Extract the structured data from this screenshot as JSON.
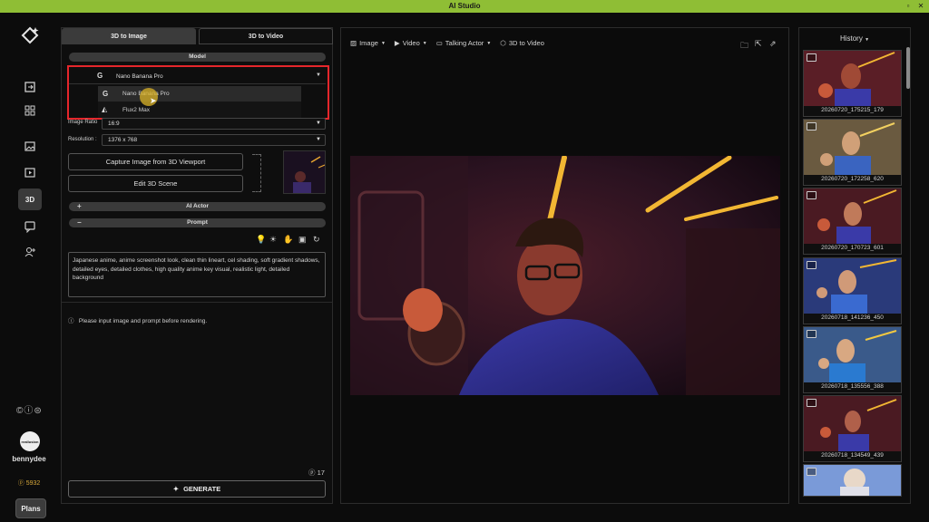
{
  "window": {
    "title": "AI Studio"
  },
  "rail": {
    "license_glyphs": "©ⓘ⊜",
    "avatar_text": "reallusion",
    "username": "bennydee",
    "points": "5932",
    "plans_label": "Plans",
    "icons": [
      "logo-icon",
      "import-icon",
      "grid-icon",
      "image-gen-icon",
      "video-gen-icon",
      "3d-icon",
      "chat-icon",
      "add-user-icon"
    ]
  },
  "left": {
    "tabs": [
      "3D to Image",
      "3D to Video"
    ],
    "model_header": "Model",
    "model_selected": "Nano Banana Pro",
    "model_options": [
      "Nano Banana Pro",
      "Flux2 Max"
    ],
    "image_ratio_label": "Image Ratio",
    "image_ratio_value": "16:9",
    "resolution_label": "Resolution :",
    "resolution_value": "1376 x 768",
    "capture_button": "Capture Image from 3D Viewport",
    "edit_button": "Edit 3D Scene",
    "ai_actor_header": "AI Actor",
    "prompt_header": "Prompt",
    "prompt_text": "Japanese anime, anime screenshot look, clean thin lineart, cel shading, soft gradient shadows, detailed eyes, detailed clothes, high quality anime key visual, realistic light, detailed background",
    "note": "Please input image and prompt before rendering.",
    "credits": "17",
    "generate_label": "GENERATE"
  },
  "center": {
    "toolbar": [
      "Image",
      "Video",
      "Talking Actor",
      "3D to Video"
    ]
  },
  "history": {
    "title": "History",
    "items": [
      "20260720_175215_179",
      "20260720_172258_620",
      "20260720_170723_601",
      "20260718_141236_450",
      "20260718_135556_388",
      "20260718_134549_439"
    ]
  },
  "colors": {
    "accent": "#8fbe35",
    "highlight_box": "#e5262b",
    "points": "#d9a93a"
  }
}
